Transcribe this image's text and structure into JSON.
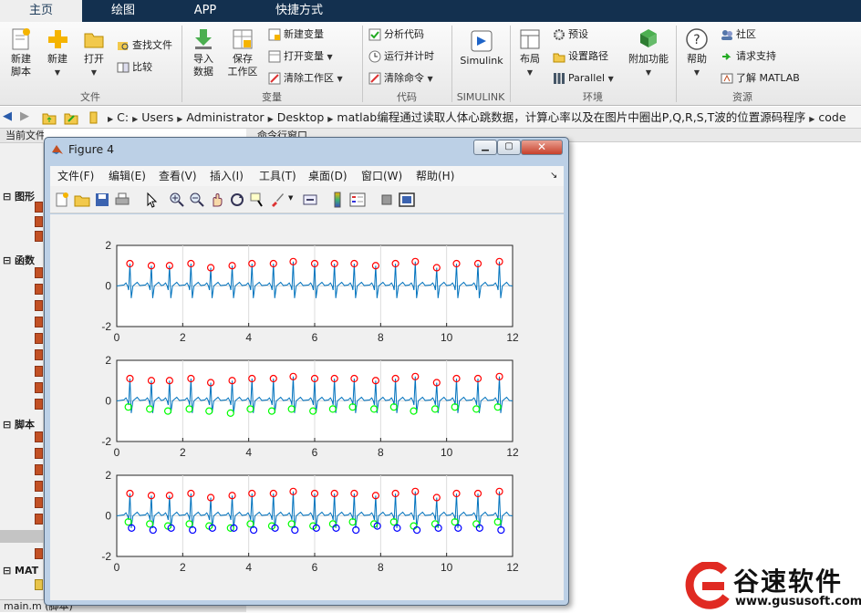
{
  "tabs": [
    "主页",
    "绘图",
    "APP",
    "快捷方式"
  ],
  "ribbon": {
    "file": {
      "new_script": "新建\n脚本",
      "new": "新建",
      "open": "打开",
      "find_files": "查找文件",
      "compare": "比较",
      "group": "文件"
    },
    "variable": {
      "import": "导入\n数据",
      "save_ws": "保存\n工作区",
      "new_var": "新建变量",
      "open_var": "打开变量",
      "clear_ws": "清除工作区",
      "group": "变量"
    },
    "code": {
      "analyze": "分析代码",
      "run_time": "运行并计时",
      "clear_cmd": "清除命令",
      "group": "代码"
    },
    "simulink": {
      "label": "Simulink",
      "group": "SIMULINK"
    },
    "env": {
      "layout": "布局",
      "prefs": "预设",
      "set_path": "设置路径",
      "parallel": "Parallel",
      "addons": "附加功能",
      "group": "环境"
    },
    "resources": {
      "help": "帮助",
      "community": "社区",
      "support": "请求支持",
      "learn": "了解 MATLAB",
      "group": "资源"
    }
  },
  "address": {
    "segments": [
      "C:",
      "Users",
      "Administrator",
      "Desktop",
      "matlab编程通过读取人体心跳数据，计算心率以及在图片中圈出P,Q,R,S,T波的位置源码程序",
      "code"
    ]
  },
  "left_panel": {
    "title": "当前文件夹",
    "sections": [
      "图形",
      "函数",
      "脚本",
      "MAT"
    ],
    "status": "main.m (脚本)"
  },
  "command_window": {
    "title": "命令行窗口"
  },
  "figure": {
    "title": "Figure 4",
    "menus": [
      "文件(F)",
      "编辑(E)",
      "查看(V)",
      "插入(I)",
      "工具(T)",
      "桌面(D)",
      "窗口(W)",
      "帮助(H)"
    ],
    "colors": {
      "signal": "#0072bd",
      "r_peak": "#ff0000",
      "s_wave": "#00ff00",
      "q_wave": "#0000ff"
    }
  },
  "chart_data": [
    {
      "type": "line",
      "title": "",
      "xlim": [
        0,
        12
      ],
      "ylim": [
        -2,
        2
      ],
      "xticks": [
        "0",
        "2",
        "4",
        "6",
        "8",
        "10",
        "12"
      ],
      "yticks": [
        "2",
        "0",
        "-2"
      ],
      "grid": true,
      "series": [
        {
          "marker": "circle",
          "color": "#ff0000",
          "x": [
            0.4,
            1.05,
            1.6,
            2.25,
            2.85,
            3.5,
            4.1,
            4.75,
            5.35,
            6.0,
            6.6,
            7.2,
            7.85,
            8.45,
            9.05,
            9.7,
            10.3,
            10.95,
            11.6
          ],
          "y": [
            1.1,
            1.0,
            1.0,
            1.1,
            0.9,
            1.0,
            1.1,
            1.1,
            1.2,
            1.1,
            1.1,
            1.1,
            1.0,
            1.1,
            1.2,
            0.9,
            1.1,
            1.1,
            1.2
          ]
        }
      ]
    },
    {
      "type": "line",
      "title": "",
      "xlim": [
        0,
        12
      ],
      "ylim": [
        -2,
        2
      ],
      "xticks": [
        "0",
        "2",
        "4",
        "6",
        "8",
        "10",
        "12"
      ],
      "yticks": [
        "2",
        "0",
        "-2"
      ],
      "grid": true,
      "series": [
        {
          "marker": "circle",
          "color": "#ff0000",
          "x": [
            0.4,
            1.05,
            1.6,
            2.25,
            2.85,
            3.5,
            4.1,
            4.75,
            5.35,
            6.0,
            6.6,
            7.2,
            7.85,
            8.45,
            9.05,
            9.7,
            10.3,
            10.95,
            11.6
          ],
          "y": [
            1.1,
            1.0,
            1.0,
            1.1,
            0.9,
            1.0,
            1.1,
            1.1,
            1.2,
            1.1,
            1.1,
            1.1,
            1.0,
            1.1,
            1.2,
            0.9,
            1.1,
            1.1,
            1.2
          ]
        },
        {
          "marker": "circle",
          "color": "#00ff00",
          "x": [
            0.35,
            1.0,
            1.55,
            2.2,
            2.8,
            3.45,
            4.05,
            4.7,
            5.3,
            5.95,
            6.55,
            7.15,
            7.8,
            8.4,
            9.0,
            9.65,
            10.25,
            10.9,
            11.55
          ],
          "y": [
            -0.3,
            -0.4,
            -0.5,
            -0.4,
            -0.5,
            -0.6,
            -0.4,
            -0.5,
            -0.4,
            -0.5,
            -0.4,
            -0.3,
            -0.4,
            -0.3,
            -0.5,
            -0.4,
            -0.3,
            -0.4,
            -0.3
          ]
        }
      ]
    },
    {
      "type": "line",
      "title": "",
      "xlim": [
        0,
        12
      ],
      "ylim": [
        -2,
        2
      ],
      "xticks": [
        "0",
        "2",
        "4",
        "6",
        "8",
        "10",
        "12"
      ],
      "yticks": [
        "2",
        "0",
        "-2"
      ],
      "grid": true,
      "series": [
        {
          "marker": "circle",
          "color": "#ff0000",
          "x": [
            0.4,
            1.05,
            1.6,
            2.25,
            2.85,
            3.5,
            4.1,
            4.75,
            5.35,
            6.0,
            6.6,
            7.2,
            7.85,
            8.45,
            9.05,
            9.7,
            10.3,
            10.95,
            11.6
          ],
          "y": [
            1.1,
            1.0,
            1.0,
            1.1,
            0.9,
            1.0,
            1.1,
            1.1,
            1.2,
            1.1,
            1.1,
            1.1,
            1.0,
            1.1,
            1.2,
            0.9,
            1.1,
            1.1,
            1.2
          ]
        },
        {
          "marker": "circle",
          "color": "#00ff00",
          "x": [
            0.35,
            1.0,
            1.55,
            2.2,
            2.8,
            3.45,
            4.05,
            4.7,
            5.3,
            5.95,
            6.55,
            7.15,
            7.8,
            8.4,
            9.0,
            9.65,
            10.25,
            10.9,
            11.55
          ],
          "y": [
            -0.3,
            -0.4,
            -0.5,
            -0.4,
            -0.5,
            -0.6,
            -0.4,
            -0.5,
            -0.4,
            -0.5,
            -0.4,
            -0.3,
            -0.4,
            -0.3,
            -0.5,
            -0.4,
            -0.3,
            -0.4,
            -0.3
          ]
        },
        {
          "marker": "circle",
          "color": "#0000ff",
          "x": [
            0.45,
            1.1,
            1.65,
            2.3,
            2.9,
            3.55,
            4.15,
            4.8,
            5.4,
            6.05,
            6.65,
            7.25,
            7.9,
            8.5,
            9.1,
            9.75,
            10.35,
            11.0,
            11.65
          ],
          "y": [
            -0.6,
            -0.7,
            -0.6,
            -0.7,
            -0.6,
            -0.6,
            -0.7,
            -0.6,
            -0.7,
            -0.6,
            -0.6,
            -0.7,
            -0.5,
            -0.6,
            -0.7,
            -0.6,
            -0.6,
            -0.6,
            -0.7
          ]
        }
      ]
    }
  ],
  "watermark": {
    "brand": "谷速软件",
    "url": "www.gususoft.com"
  }
}
